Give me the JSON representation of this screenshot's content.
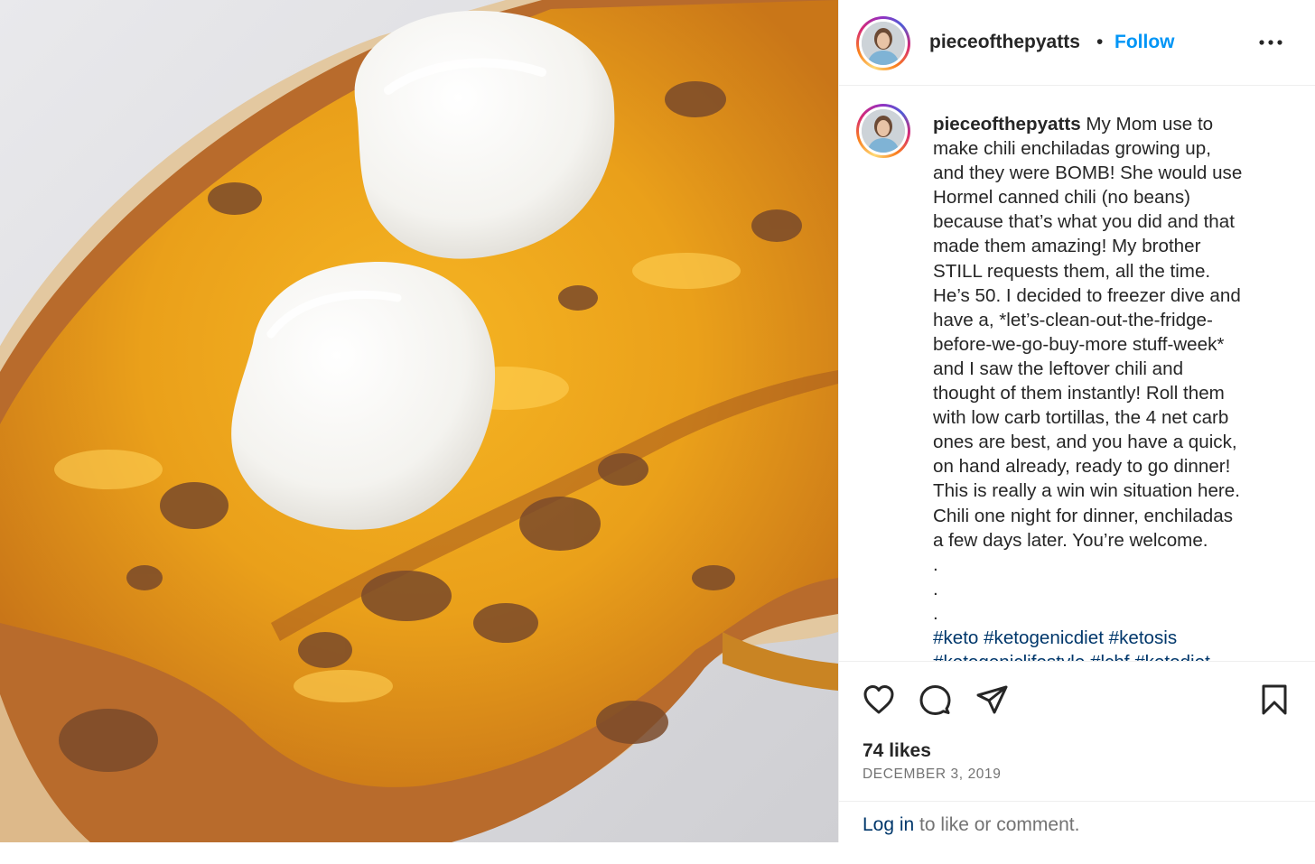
{
  "post": {
    "username": "pieceofthepyatts",
    "separator": "•",
    "follow_label": "Follow",
    "more_icon": "more-options-icon",
    "caption": {
      "username": "pieceofthepyatts",
      "lines": [
        " My Mom use to",
        "make chili enchiladas growing up,",
        "and they were BOMB! She would use",
        "Hormel canned chili (no beans)",
        "because that’s what you did and that",
        "made them amazing! My brother",
        "STILL requests them, all the time.",
        "He’s 50. I decided to freezer dive and",
        "have a, *let’s-clean-out-the-fridge-",
        "before-we-go-buy-more stuff-week*",
        "and I saw the leftover chili and",
        "thought of them instantly! Roll them",
        "with low carb tortillas, the 4 net carb",
        "ones are best, and you have a quick,",
        "on hand already, ready to go dinner!",
        "This is really a win win situation here.",
        "Chili one night for dinner, enchiladas",
        "a few days later. You’re welcome.",
        ".",
        ".",
        "."
      ],
      "hashtags_line1": "#keto #ketogenicdiet #ketosis",
      "hashtags_line2": "#ketogeniclifestyle #lchf #ketodiet"
    },
    "actions": {
      "like_icon": "heart-icon",
      "comment_icon": "comment-icon",
      "share_icon": "share-icon",
      "save_icon": "bookmark-icon"
    },
    "likes": "74 likes",
    "date": "DECEMBER 3, 2019",
    "login_link": "Log in",
    "login_rest": " to like or comment."
  },
  "colors": {
    "follow": "#0095f6",
    "link": "#00376b",
    "secondary_text": "#737373"
  }
}
